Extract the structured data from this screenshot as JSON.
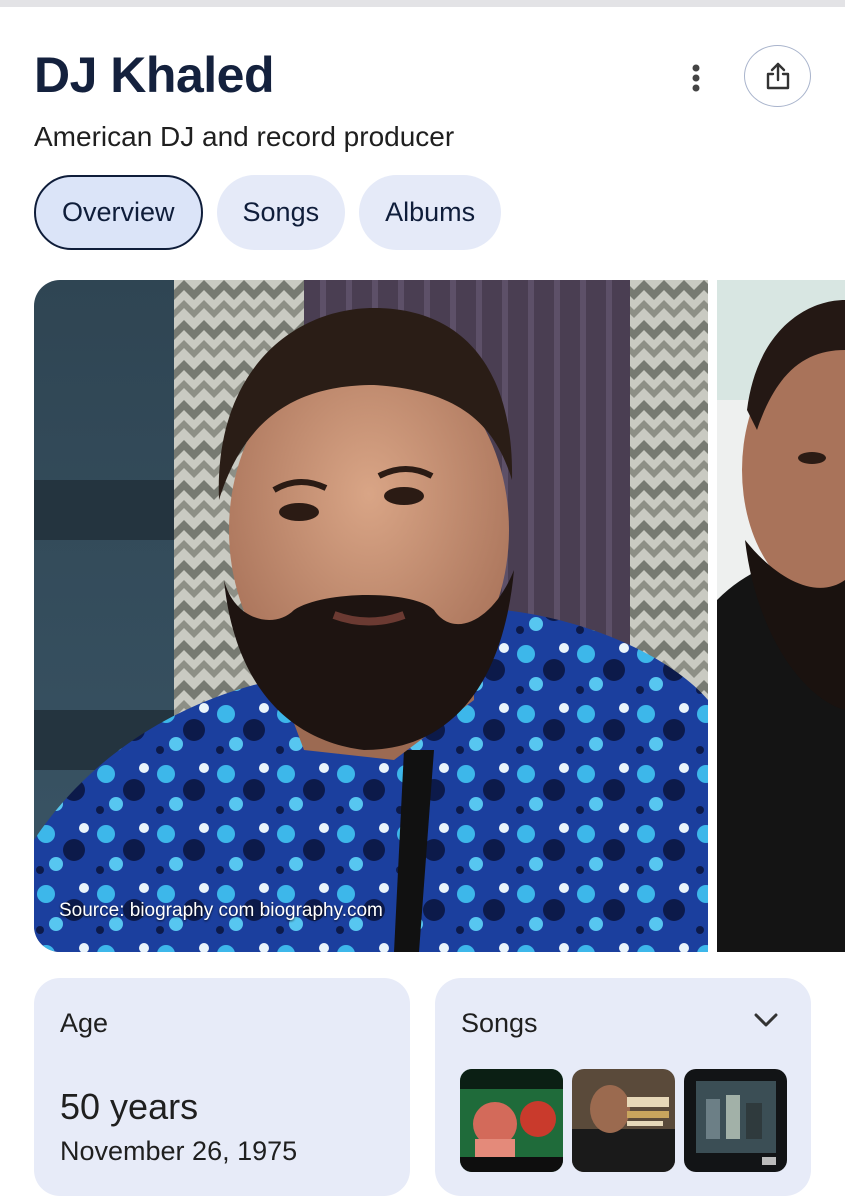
{
  "header": {
    "title": "DJ Khaled",
    "subtitle": "American DJ and record producer",
    "more_icon": "more-vert-icon",
    "share_icon": "share-icon"
  },
  "tabs": [
    {
      "label": "Overview",
      "active": true
    },
    {
      "label": "Songs",
      "active": false
    },
    {
      "label": "Albums",
      "active": false
    }
  ],
  "images": {
    "source_caption": "Source: biography com biography.com"
  },
  "age_card": {
    "label": "Age",
    "value": "50 years",
    "date": "November 26, 1975"
  },
  "songs_card": {
    "label": "Songs",
    "expand_icon": "chevron-down-icon",
    "thumb_count": 3
  },
  "colors": {
    "title": "#14213d",
    "tab_bg": "#e5eaf8",
    "card_bg": "#e7ebf8",
    "outline": "#0f1d3a"
  }
}
